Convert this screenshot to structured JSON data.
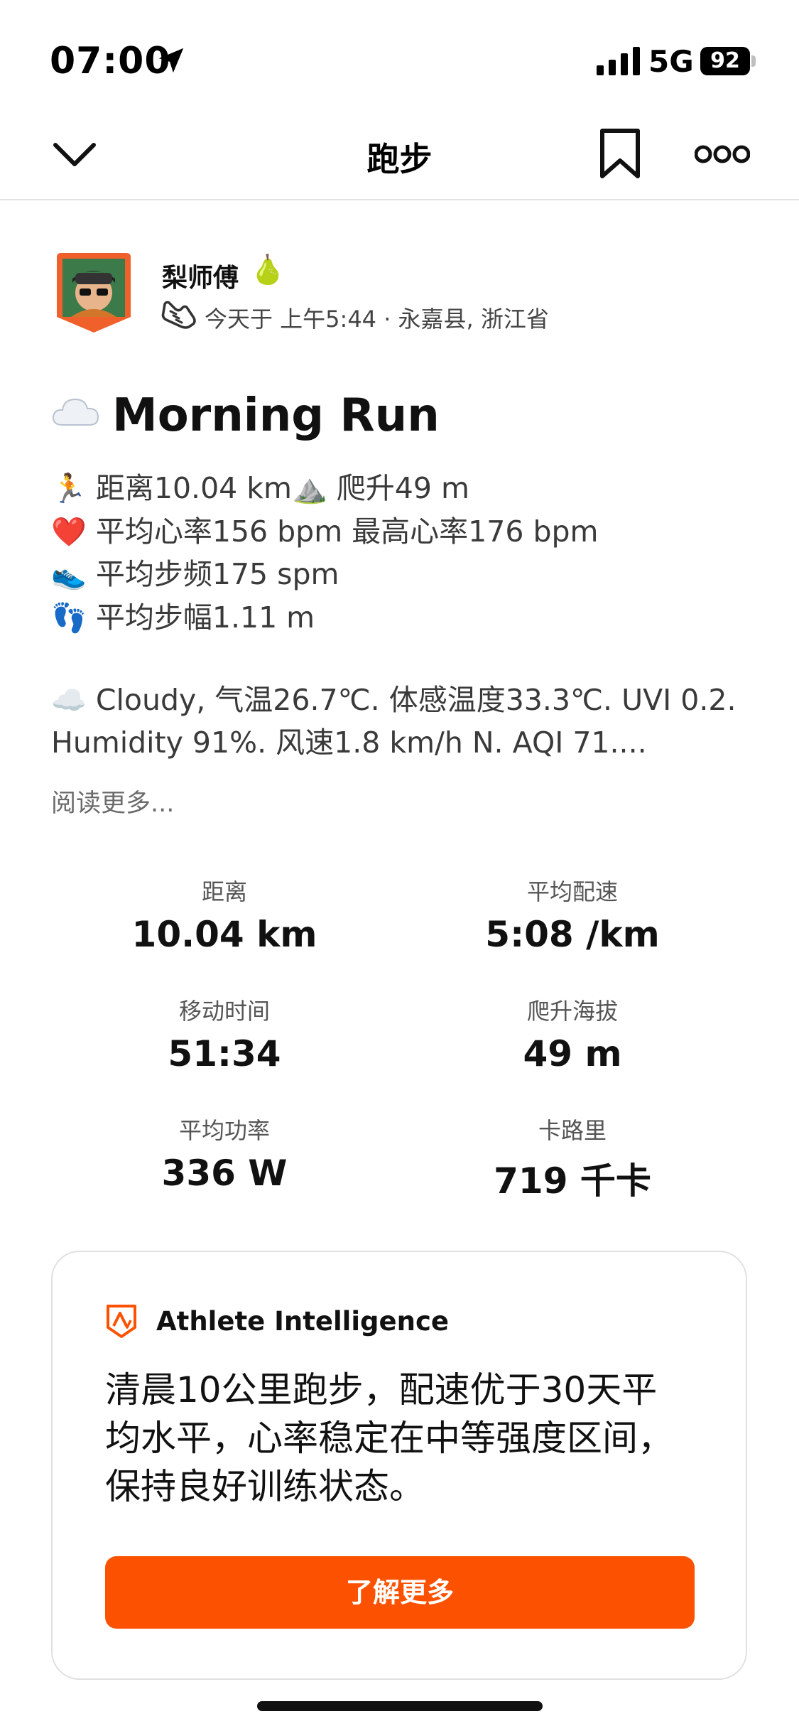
{
  "status_bar": {
    "time": "07:00",
    "network": "5G",
    "battery": "92"
  },
  "nav": {
    "title": "跑步",
    "icons": [
      "chevron-down-icon",
      "bookmark-icon",
      "more-icon"
    ]
  },
  "athlete": {
    "name": "梨师傅",
    "name_emoji": "🍐",
    "meta": "今天于 上午5:44 · 永嘉县, 浙江省"
  },
  "activity": {
    "title_emoji": "cloud-icon",
    "title": "Morning Run",
    "description_lines": [
      {
        "emoji": "🏃",
        "text": "距离10.04 km",
        "emoji2": "⛰️",
        "text2": "爬升49 m"
      },
      {
        "emoji": "❤️",
        "text": "平均心率156 bpm 最高心率176 bpm"
      },
      {
        "emoji": "👟",
        "text": "平均步频175 spm"
      },
      {
        "emoji": "👣",
        "text": "平均步幅1.11 m"
      }
    ],
    "weather_emoji": "☁️",
    "weather_text_1": "Cloudy, 气温26.7℃. 体感温度33.3℃. UVI 0.2.",
    "weather_text_2": "Humidity 91%. 风速1.8 km/h N. AQI 71....",
    "read_more": "阅读更多..."
  },
  "stats": [
    {
      "label": "距离",
      "value": "10.04 km"
    },
    {
      "label": "平均配速",
      "value": "5:08 /km"
    },
    {
      "label": "移动时间",
      "value": "51:34"
    },
    {
      "label": "爬升海拔",
      "value": "49 m"
    },
    {
      "label": "平均功率",
      "value": "336 W"
    },
    {
      "label": "卡路里",
      "value": "719 千卡"
    }
  ],
  "athlete_intelligence": {
    "title": "Athlete Intelligence",
    "summary": "清晨10公里跑步，配速优于30天平均水平，心率稳定在中等强度区间，保持良好训练状态。",
    "button": "了解更多"
  },
  "colors": {
    "accent": "#fc5200",
    "text": "#111111",
    "muted": "#6b6b6b"
  }
}
